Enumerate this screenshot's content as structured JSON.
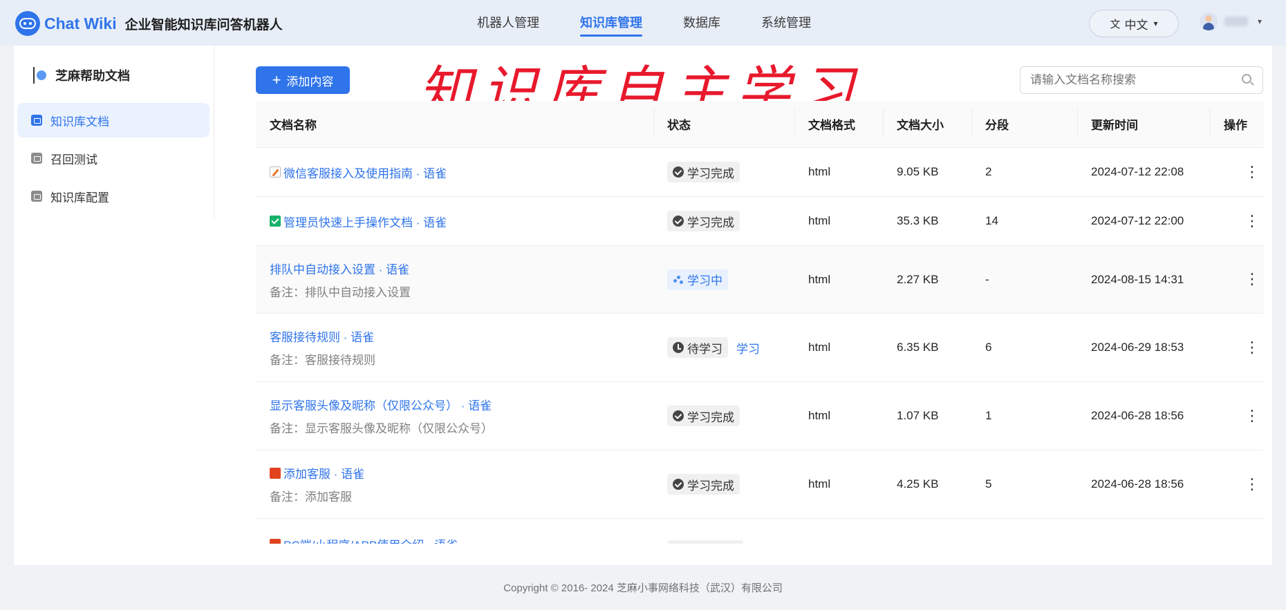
{
  "header": {
    "brand": "Chat Wiki",
    "subtitle": "企业智能知识库问答机器人",
    "nav": [
      {
        "label": "机器人管理",
        "active": false
      },
      {
        "label": "知识库管理",
        "active": true
      },
      {
        "label": "数据库",
        "active": false
      },
      {
        "label": "系统管理",
        "active": false
      }
    ],
    "language": "中文"
  },
  "sidebar": {
    "kb_name": "芝麻帮助文档",
    "items": [
      {
        "label": "知识库文档",
        "active": true
      },
      {
        "label": "召回测试",
        "active": false
      },
      {
        "label": "知识库配置",
        "active": false
      }
    ]
  },
  "toolbar": {
    "add_label": "添加内容",
    "banner": "知识库自主学习",
    "search_placeholder": "请输入文档名称搜索"
  },
  "table": {
    "columns": [
      "文档名称",
      "状态",
      "文档格式",
      "文档大小",
      "分段",
      "更新时间",
      "操作"
    ],
    "rows": [
      {
        "icon": "memo-icon",
        "name": "微信客服接入及使用指南 · 语雀",
        "note": "",
        "status": "学习完成",
        "status_type": "done",
        "format": "html",
        "size": "9.05 KB",
        "segments": "2",
        "updated": "2024-07-12 22:08"
      },
      {
        "icon": "check-icon",
        "name": "管理员快速上手操作文档 · 语雀",
        "note": "",
        "status": "学习完成",
        "status_type": "done",
        "format": "html",
        "size": "35.3 KB",
        "segments": "14",
        "updated": "2024-07-12 22:00"
      },
      {
        "icon": "",
        "name": "排队中自动接入设置 · 语雀",
        "note": "备注：排队中自动接入设置",
        "status": "学习中",
        "status_type": "learning",
        "format": "html",
        "size": "2.27 KB",
        "segments": "-",
        "updated": "2024-08-15 14:31"
      },
      {
        "icon": "",
        "name": "客服接待规则 · 语雀",
        "note": "备注：客服接待规则",
        "status": "待学习",
        "status_type": "pending",
        "action": "学习",
        "format": "html",
        "size": "6.35 KB",
        "segments": "6",
        "updated": "2024-06-29 18:53"
      },
      {
        "icon": "",
        "name": "显示客服头像及昵称（仅限公众号） · 语雀",
        "note": "备注：显示客服头像及昵称（仅限公众号）",
        "status": "学习完成",
        "status_type": "done",
        "format": "html",
        "size": "1.07 KB",
        "segments": "1",
        "updated": "2024-06-28 18:56"
      },
      {
        "icon": "book-icon",
        "name": "添加客服 · 语雀",
        "note": "备注：添加客服",
        "status": "学习完成",
        "status_type": "done",
        "format": "html",
        "size": "4.25 KB",
        "segments": "5",
        "updated": "2024-06-28 18:56"
      },
      {
        "icon": "book-icon",
        "name": "PC端/小程序/APP使用介绍 · 语雀",
        "note": "",
        "status": "",
        "status_type": "partial",
        "format": "",
        "size": "",
        "segments": "",
        "updated": ""
      }
    ]
  },
  "footer": {
    "copyright": "Copyright © 2016- 2024 芝麻小事网络科技（武汉）有限公司"
  },
  "colors": {
    "accent": "#2f74eb",
    "banner": "#e8192c",
    "header_bg": "#e8eef8"
  }
}
